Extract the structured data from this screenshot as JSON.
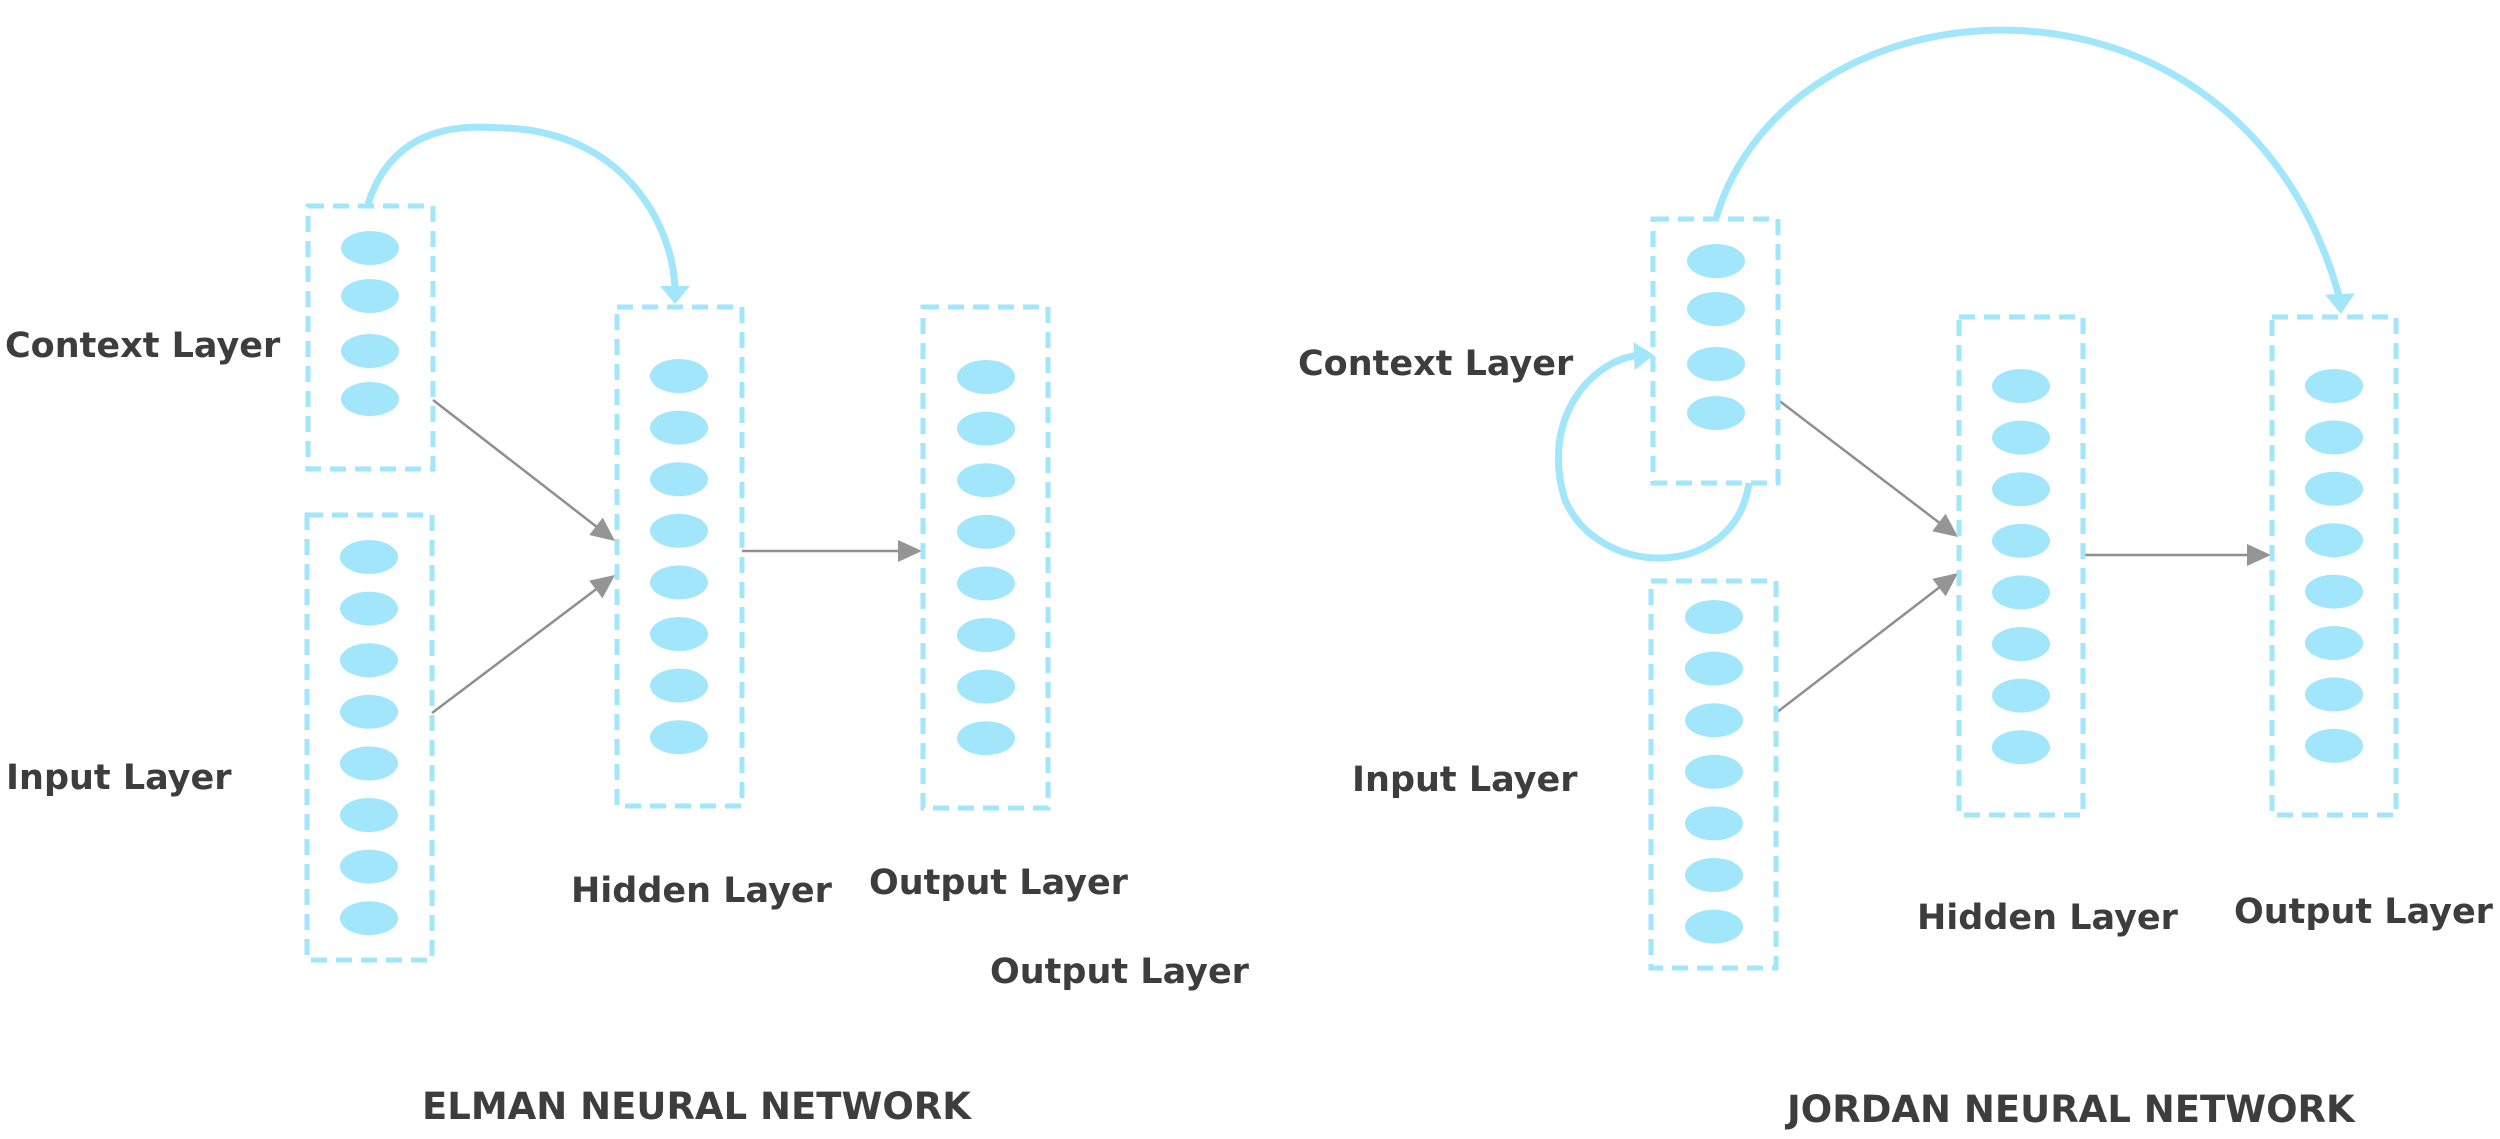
{
  "colors": {
    "node": "#a1e6fb",
    "box_border": "#a1e6fb",
    "recurrent_arrow": "#a1e6fb",
    "forward_arrow": "#959595",
    "text": "#3d3d3d",
    "background": "#ffffff"
  },
  "diagrams": [
    {
      "id": "elman",
      "title": "ELMAN NEURAL NETWORK",
      "layers": {
        "context": {
          "label": "Context Layer",
          "node_count": 4
        },
        "input": {
          "label": "Input Layer",
          "node_count": 8
        },
        "hidden": {
          "label": "Hidden Layer",
          "node_count": 8
        },
        "output": {
          "label": "Output Layer",
          "node_count": 8
        }
      },
      "extra_labels": [
        "Output Layer"
      ],
      "connections": [
        {
          "from": "context",
          "to": "hidden",
          "kind": "forward"
        },
        {
          "from": "input",
          "to": "hidden",
          "kind": "forward"
        },
        {
          "from": "hidden",
          "to": "output",
          "kind": "forward"
        },
        {
          "from": "context",
          "to": "hidden",
          "kind": "recurrent"
        }
      ]
    },
    {
      "id": "jordan",
      "title": "JORDAN NEURAL NETWORK",
      "layers": {
        "context": {
          "label": "Context Layer",
          "node_count": 4
        },
        "input": {
          "label": "Input Layer",
          "node_count": 7
        },
        "hidden": {
          "label": "Hidden Layer",
          "node_count": 8
        },
        "output": {
          "label": "Output Layer",
          "node_count": 8
        }
      },
      "extra_labels": [],
      "connections": [
        {
          "from": "context",
          "to": "hidden",
          "kind": "forward"
        },
        {
          "from": "input",
          "to": "hidden",
          "kind": "forward"
        },
        {
          "from": "hidden",
          "to": "output",
          "kind": "forward"
        },
        {
          "from": "context",
          "to": "output",
          "kind": "recurrent"
        },
        {
          "from": "context",
          "to": "context",
          "kind": "self-loop"
        }
      ]
    }
  ]
}
